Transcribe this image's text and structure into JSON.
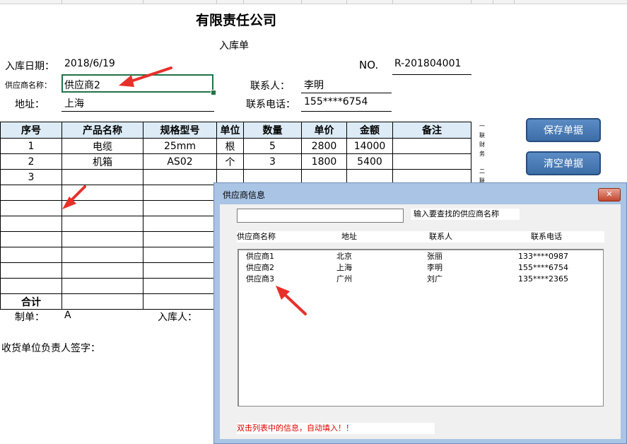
{
  "sheet": {
    "company_title": "有限责任公司",
    "form_title": "入库单",
    "date_label": "入库日期：",
    "date_value": "2018/6/19",
    "no_label": "NO.",
    "no_value": "R-201804001",
    "supplier_label": "供应商名称：",
    "supplier_value": "供应商2",
    "contact_label": "联系人：",
    "contact_value": "李明",
    "address_label": "地址：",
    "address_value": "上海",
    "phone_label": "联系电话：",
    "phone_value": "155****6754",
    "table": {
      "headers": [
        "序号",
        "产品名称",
        "规格型号",
        "单位",
        "数量",
        "单价",
        "金额",
        "备注"
      ],
      "rows": [
        [
          "1",
          "电缆",
          "25mm",
          "根",
          "5",
          "2800",
          "14000",
          ""
        ],
        [
          "2",
          "机箱",
          "AS02",
          "个",
          "3",
          "1800",
          "5400",
          ""
        ],
        [
          "3",
          "",
          "",
          "",
          "",
          "",
          "",
          ""
        ]
      ],
      "total_label": "合计"
    },
    "maker_label": "制单：",
    "maker_value": "A",
    "receiver_label": "入库人：",
    "signature_label": "收货单位负责人签字：",
    "side_note_1": [
      "一",
      "联",
      "财",
      "务"
    ],
    "side_note_2": [
      "二",
      "联"
    ]
  },
  "buttons": {
    "save_label": "保存单据",
    "clear_label": "清空单据"
  },
  "dialog": {
    "title": "供应商信息",
    "close_glyph": "✕",
    "search_value": "",
    "search_hint": "输入要查找的供应商名称",
    "columns": [
      "供应商名称",
      "地址",
      "联系人",
      "联系电话"
    ],
    "rows": [
      [
        "供应商1",
        "北京",
        "张丽",
        "133****0987"
      ],
      [
        "供应商2",
        "上海",
        "李明",
        "155****6754"
      ],
      [
        "供应商3",
        "广州",
        "刘广",
        "135****2365"
      ]
    ],
    "note": "双击列表中的信息，自动填入！！"
  },
  "colors": {
    "header_fill": "#dcebf5",
    "selection_border": "#217346",
    "button_fill": "#4a7db8",
    "dialog_frame": "#a9c4e4",
    "arrow_red": "#e8302a",
    "note_red": "#e00000"
  }
}
